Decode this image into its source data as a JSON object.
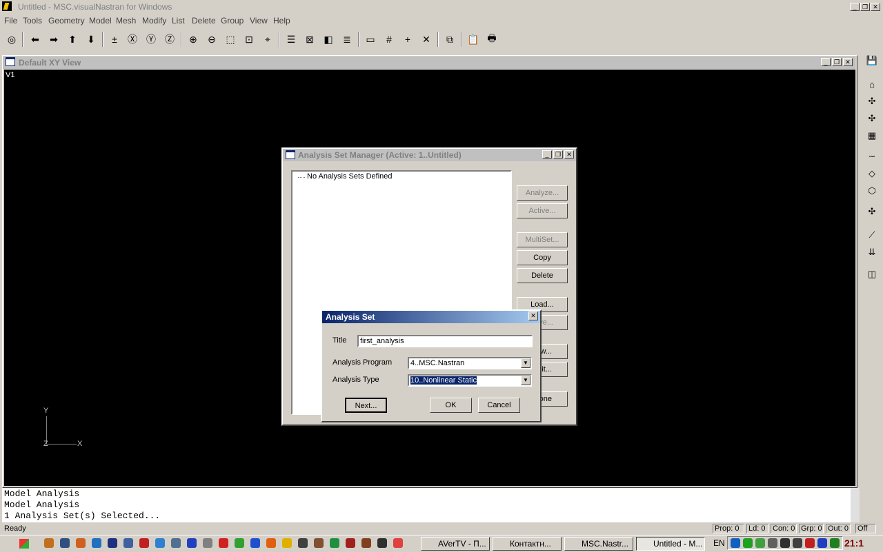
{
  "app": {
    "title": "Untitled - MSC.visualNastran for Windows"
  },
  "menu": [
    "File",
    "Tools",
    "Geometry",
    "Model",
    "Mesh",
    "Modify",
    "List",
    "Delete",
    "Group",
    "View",
    "Help"
  ],
  "view_window": {
    "title": "Default XY View",
    "view_label": "V1",
    "axes": {
      "y": "Y",
      "z": "Z",
      "x": "X"
    }
  },
  "analysis_manager": {
    "title": "Analysis Set Manager (Active: 1..Untitled)",
    "tree_text": "No Analysis Sets Defined",
    "buttons": {
      "analyze": "Analyze...",
      "active": "Active...",
      "multiset": "MultiSet...",
      "copy": "Copy",
      "delete": "Delete",
      "load": "Load...",
      "save_partial": "ve...",
      "new_partial": "w...",
      "edit_partial": "lit...",
      "done_partial": "one"
    }
  },
  "analysis_set": {
    "title": "Analysis Set",
    "title_label": "Title",
    "title_value": "first_analysis",
    "program_label": "Analysis Program",
    "program_value": "4..MSC.Nastran",
    "type_label": "Analysis Type",
    "type_value": "10..Nonlinear Static",
    "next": "Next...",
    "ok": "OK",
    "cancel": "Cancel"
  },
  "messages": [
    "Model Analysis",
    "Model Analysis",
    "1 Analysis Set(s) Selected..."
  ],
  "status": {
    "ready": "Ready",
    "prop": "Prop: 0",
    "ld": "Ld: 0",
    "con": "Con: 0",
    "grp": "Grp: 0",
    "out": "Out: 0",
    "off": "Off"
  },
  "taskbar": {
    "tasks": [
      "AVerTV - П...",
      "Контактн...",
      "MSC.Nastr...",
      "Untitled - M..."
    ],
    "lang": "EN",
    "clock": "21:1"
  }
}
